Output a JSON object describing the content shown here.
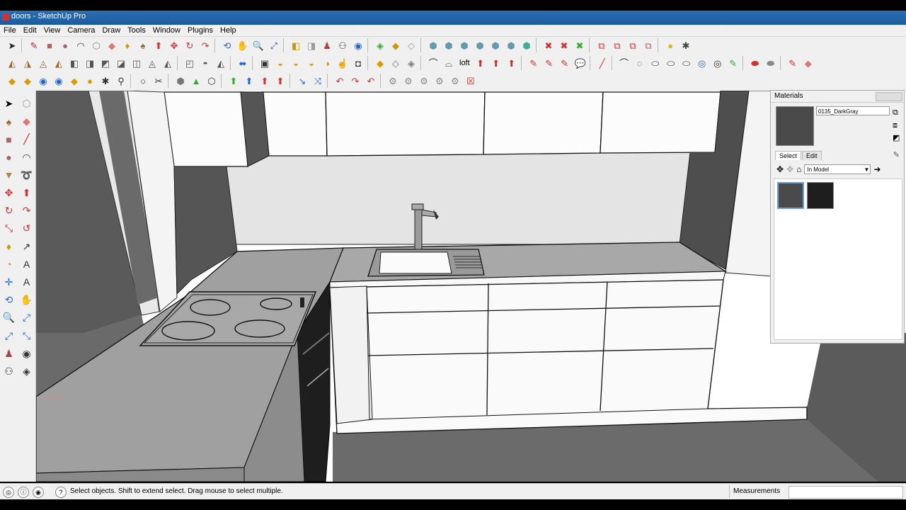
{
  "window": {
    "title": "doors - SketchUp Pro"
  },
  "menu": [
    "File",
    "Edit",
    "View",
    "Camera",
    "Draw",
    "Tools",
    "Window",
    "Plugins",
    "Help"
  ],
  "toolbar": {
    "loft_label": "loft"
  },
  "materials_panel": {
    "title": "Materials",
    "material_name": "0135_DarkGray",
    "tabs": [
      "Select",
      "Edit"
    ],
    "collection": "In Model",
    "colors": {
      "selected_swatch": "#4a4a4a",
      "second_swatch": "#1e1e1e"
    }
  },
  "status": {
    "message": "Select objects. Shift to extend select. Drag mouse to select multiple.",
    "measurements_label": "Measurements",
    "measurements_value": ""
  }
}
